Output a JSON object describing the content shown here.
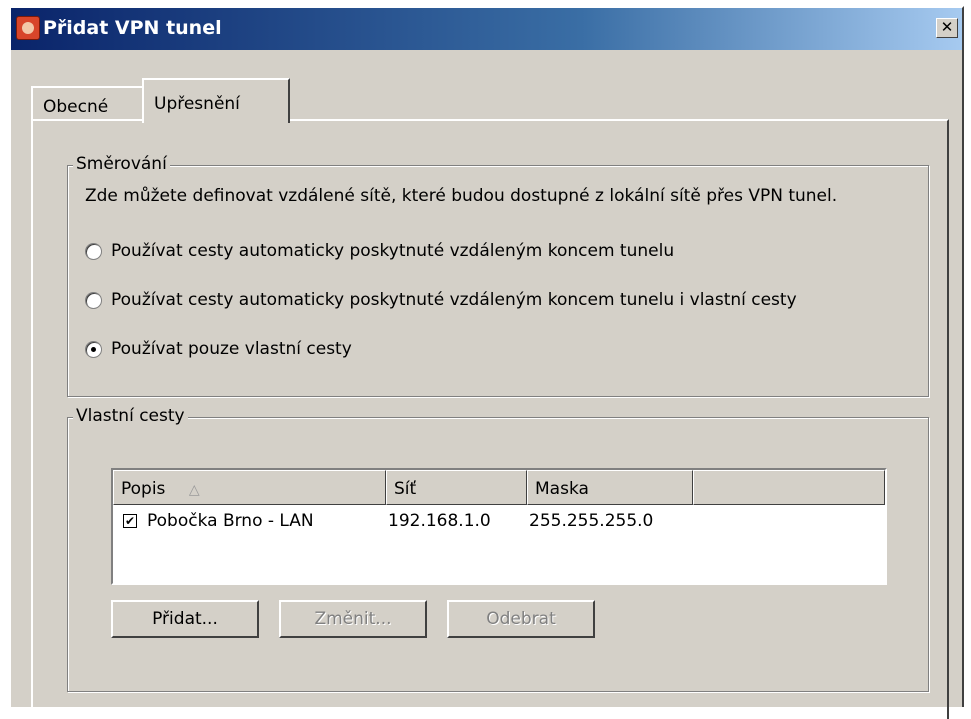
{
  "window": {
    "title": "Přidat VPN tunel",
    "close_symbol": "✕"
  },
  "tabs": [
    {
      "label": "Obecné",
      "active": false
    },
    {
      "label": "Upřesnění",
      "active": true
    }
  ],
  "routing": {
    "legend": "Směrování",
    "description": "Zde můžete definovat vzdálené sítě, které budou dostupné z lokální sítě přes VPN tunel.",
    "options": [
      {
        "label": "Používat cesty automaticky poskytnuté vzdáleným koncem tunelu",
        "checked": false
      },
      {
        "label": "Používat cesty automaticky poskytnuté vzdáleným koncem tunelu i vlastní cesty",
        "checked": false
      },
      {
        "label": "Používat pouze vlastní cesty",
        "checked": true
      }
    ]
  },
  "own_routes": {
    "legend": "Vlastní cesty",
    "columns": [
      "Popis",
      "Síť",
      "Maska",
      ""
    ],
    "sort_icon": "△",
    "rows": [
      {
        "checked": true,
        "check_glyph": "✔",
        "popis": "Pobočka Brno - LAN",
        "sit": "192.168.1.0",
        "maska": "255.255.255.0"
      }
    ],
    "buttons": {
      "add": "Přidat...",
      "edit": "Změnit...",
      "remove": "Odebrat"
    }
  }
}
